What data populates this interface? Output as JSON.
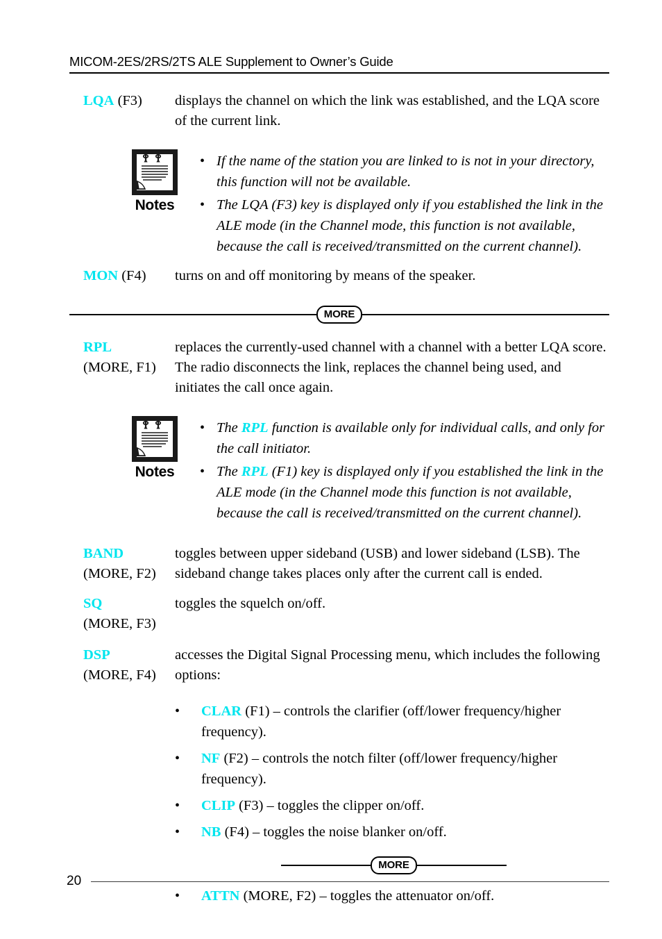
{
  "header": {
    "title": "MICOM-2ES/2RS/2TS ALE Supplement to Owner’s Guide"
  },
  "colors": {
    "key_accent": "#00e5ee",
    "text": "#000000",
    "background": "#ffffff"
  },
  "entries": [
    {
      "key": "LQA",
      "key_suffix": " (F3)",
      "key_line2": "",
      "description": "displays the channel on which the link was established, and the LQA score of the current link."
    },
    {
      "key": "MON",
      "key_suffix": " (F4)",
      "key_line2": "",
      "description": "turns on and off monitoring by means of the speaker."
    },
    {
      "key": "RPL",
      "key_suffix": "",
      "key_line2": "(MORE, F1)",
      "description": "replaces the currently-used channel with a channel with a better LQA score. The radio disconnects the link, replaces the channel being used, and initiates the call once again."
    },
    {
      "key": "BAND",
      "key_suffix": "",
      "key_line2": "(MORE, F2)",
      "description": "toggles between upper sideband (USB) and lower sideband (LSB). The sideband change takes places only after the current call is ended."
    },
    {
      "key": "SQ",
      "key_suffix": "",
      "key_line2": "(MORE, F3)",
      "description": "toggles the squelch on/off."
    },
    {
      "key": "DSP",
      "key_suffix": "",
      "key_line2": "(MORE, F4)",
      "description": "accesses the Digital Signal Processing menu, which includes the following options:"
    }
  ],
  "notes_blocks": [
    {
      "caption": "Notes",
      "icon": "notepad-icon",
      "items": [
        {
          "bullet": "•",
          "pre": "If the name of the station you are linked to is not in your directory, this function will not be available.",
          "key": "",
          "post": ""
        },
        {
          "bullet": "•",
          "pre": "The LQA (F3) key is displayed only if you established the link in the ALE mode (in the Channel mode, this function is not available, because the call is received/transmitted on the current channel).",
          "key": "",
          "post": ""
        }
      ]
    },
    {
      "caption": "Notes",
      "icon": "notepad-icon",
      "items": [
        {
          "bullet": "•",
          "pre": "The ",
          "key": "RPL",
          "post": " function is available only for individual calls, and only for the call initiator."
        },
        {
          "bullet": "•",
          "pre": "The ",
          "key": "RPL",
          "post": " (F1) key is displayed only if you established the link in the ALE mode (in the Channel mode this function is not available, because the call is received/transmitted on the current channel)."
        }
      ]
    }
  ],
  "separators": {
    "badge_label": "MORE"
  },
  "dsp_options": [
    {
      "bullet": "•",
      "key": "CLAR",
      "text": " (F1) – controls the clarifier (off/lower frequency/higher frequency)."
    },
    {
      "bullet": "•",
      "key": "NF",
      "text": " (F2) – controls the notch filter (off/lower frequency/higher frequency)."
    },
    {
      "bullet": "•",
      "key": "CLIP",
      "text": " (F3) – toggles the clipper on/off."
    },
    {
      "bullet": "•",
      "key": "NB",
      "text": " (F4) – toggles the noise blanker on/off."
    }
  ],
  "dsp_options_after_more": [
    {
      "bullet": "•",
      "key": "ATTN",
      "text": " (MORE, F2) – toggles the attenuator on/off."
    }
  ],
  "footer": {
    "page_number": "20"
  }
}
